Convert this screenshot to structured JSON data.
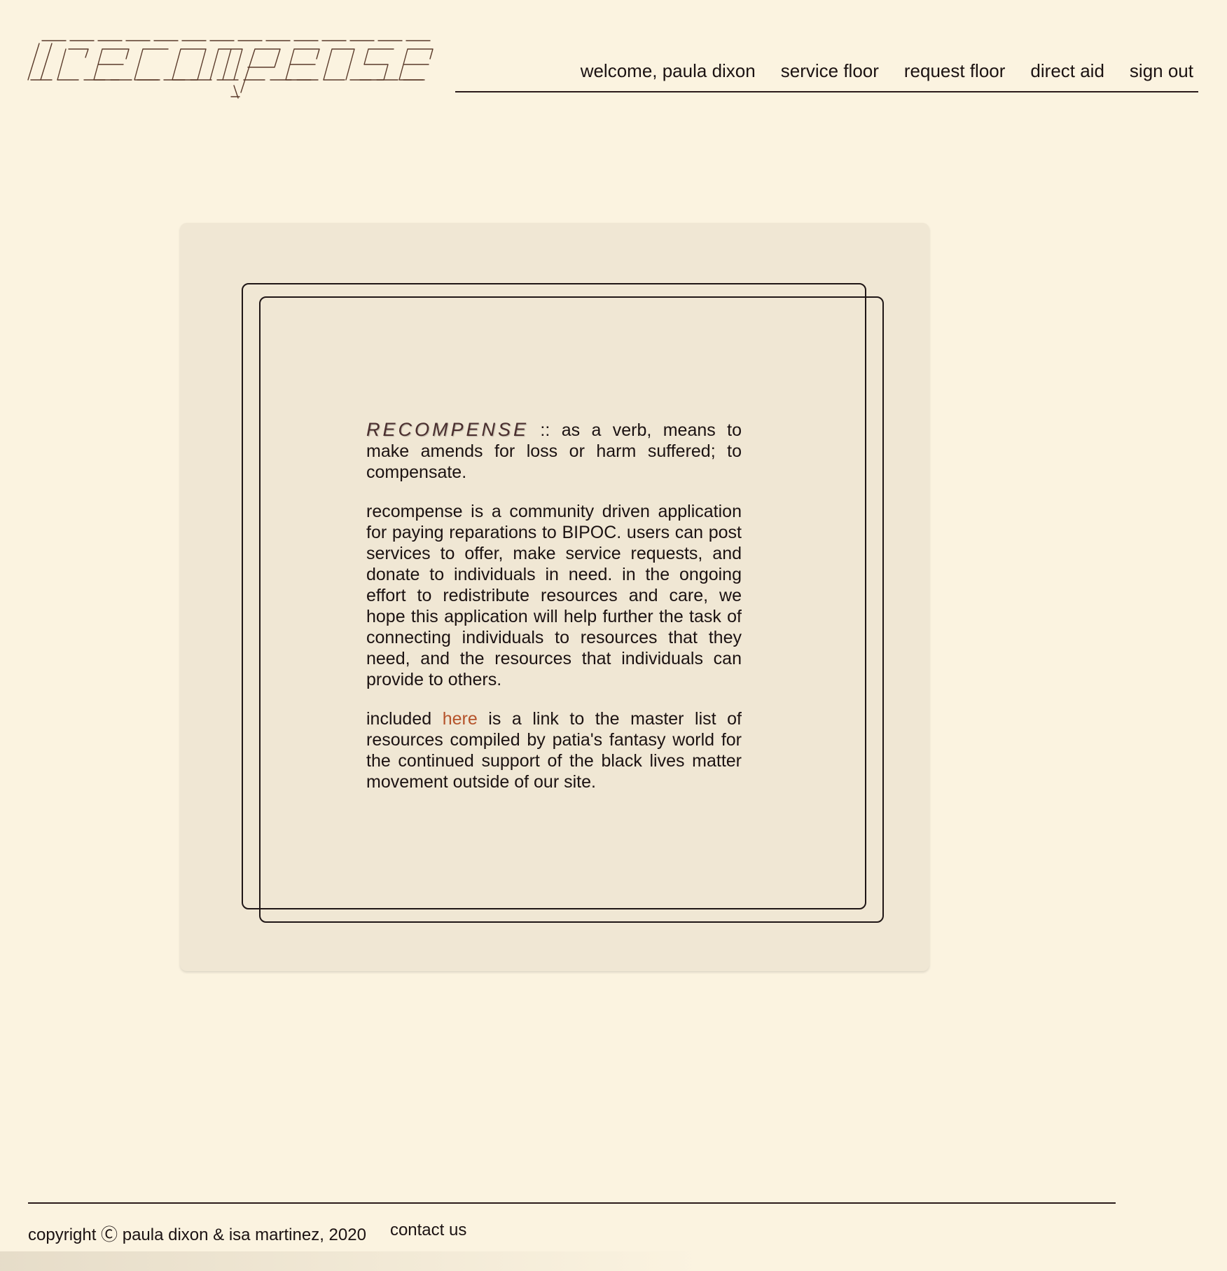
{
  "header": {
    "logo_text": "recompense",
    "nav": {
      "welcome": "welcome, paula dixon",
      "service_floor": "service floor",
      "request_floor": "request floor",
      "direct_aid": "direct aid",
      "sign_out": "sign out"
    }
  },
  "main": {
    "definition": {
      "term": "RECOMPENSE",
      "text": " :: as a verb, means to make amends for loss or harm suffered; to compensate."
    },
    "description": "recompense is a community driven application for paying reparations to BIPOC. users can post services to offer, make service requests, and donate to individuals in need. in the ongoing effort to redistribute resources and care, we hope this application will help further the task of connecting individuals to resources that they need, and the resources that individuals can provide to others.",
    "resources": {
      "before": "included ",
      "link_label": "here",
      "after": " is a link to the master list of resources compiled by patia's fantasy world for the continued support of the black lives matter movement outside of our site."
    }
  },
  "footer": {
    "copyright": "copyright Ⓒ paula dixon & isa martinez, 2020",
    "contact": "contact us"
  },
  "colors": {
    "background": "#fbf3e0",
    "card": "#f0e7d4",
    "text": "#1b1212",
    "link": "#b5532a",
    "logo": "#5a3a2a"
  }
}
